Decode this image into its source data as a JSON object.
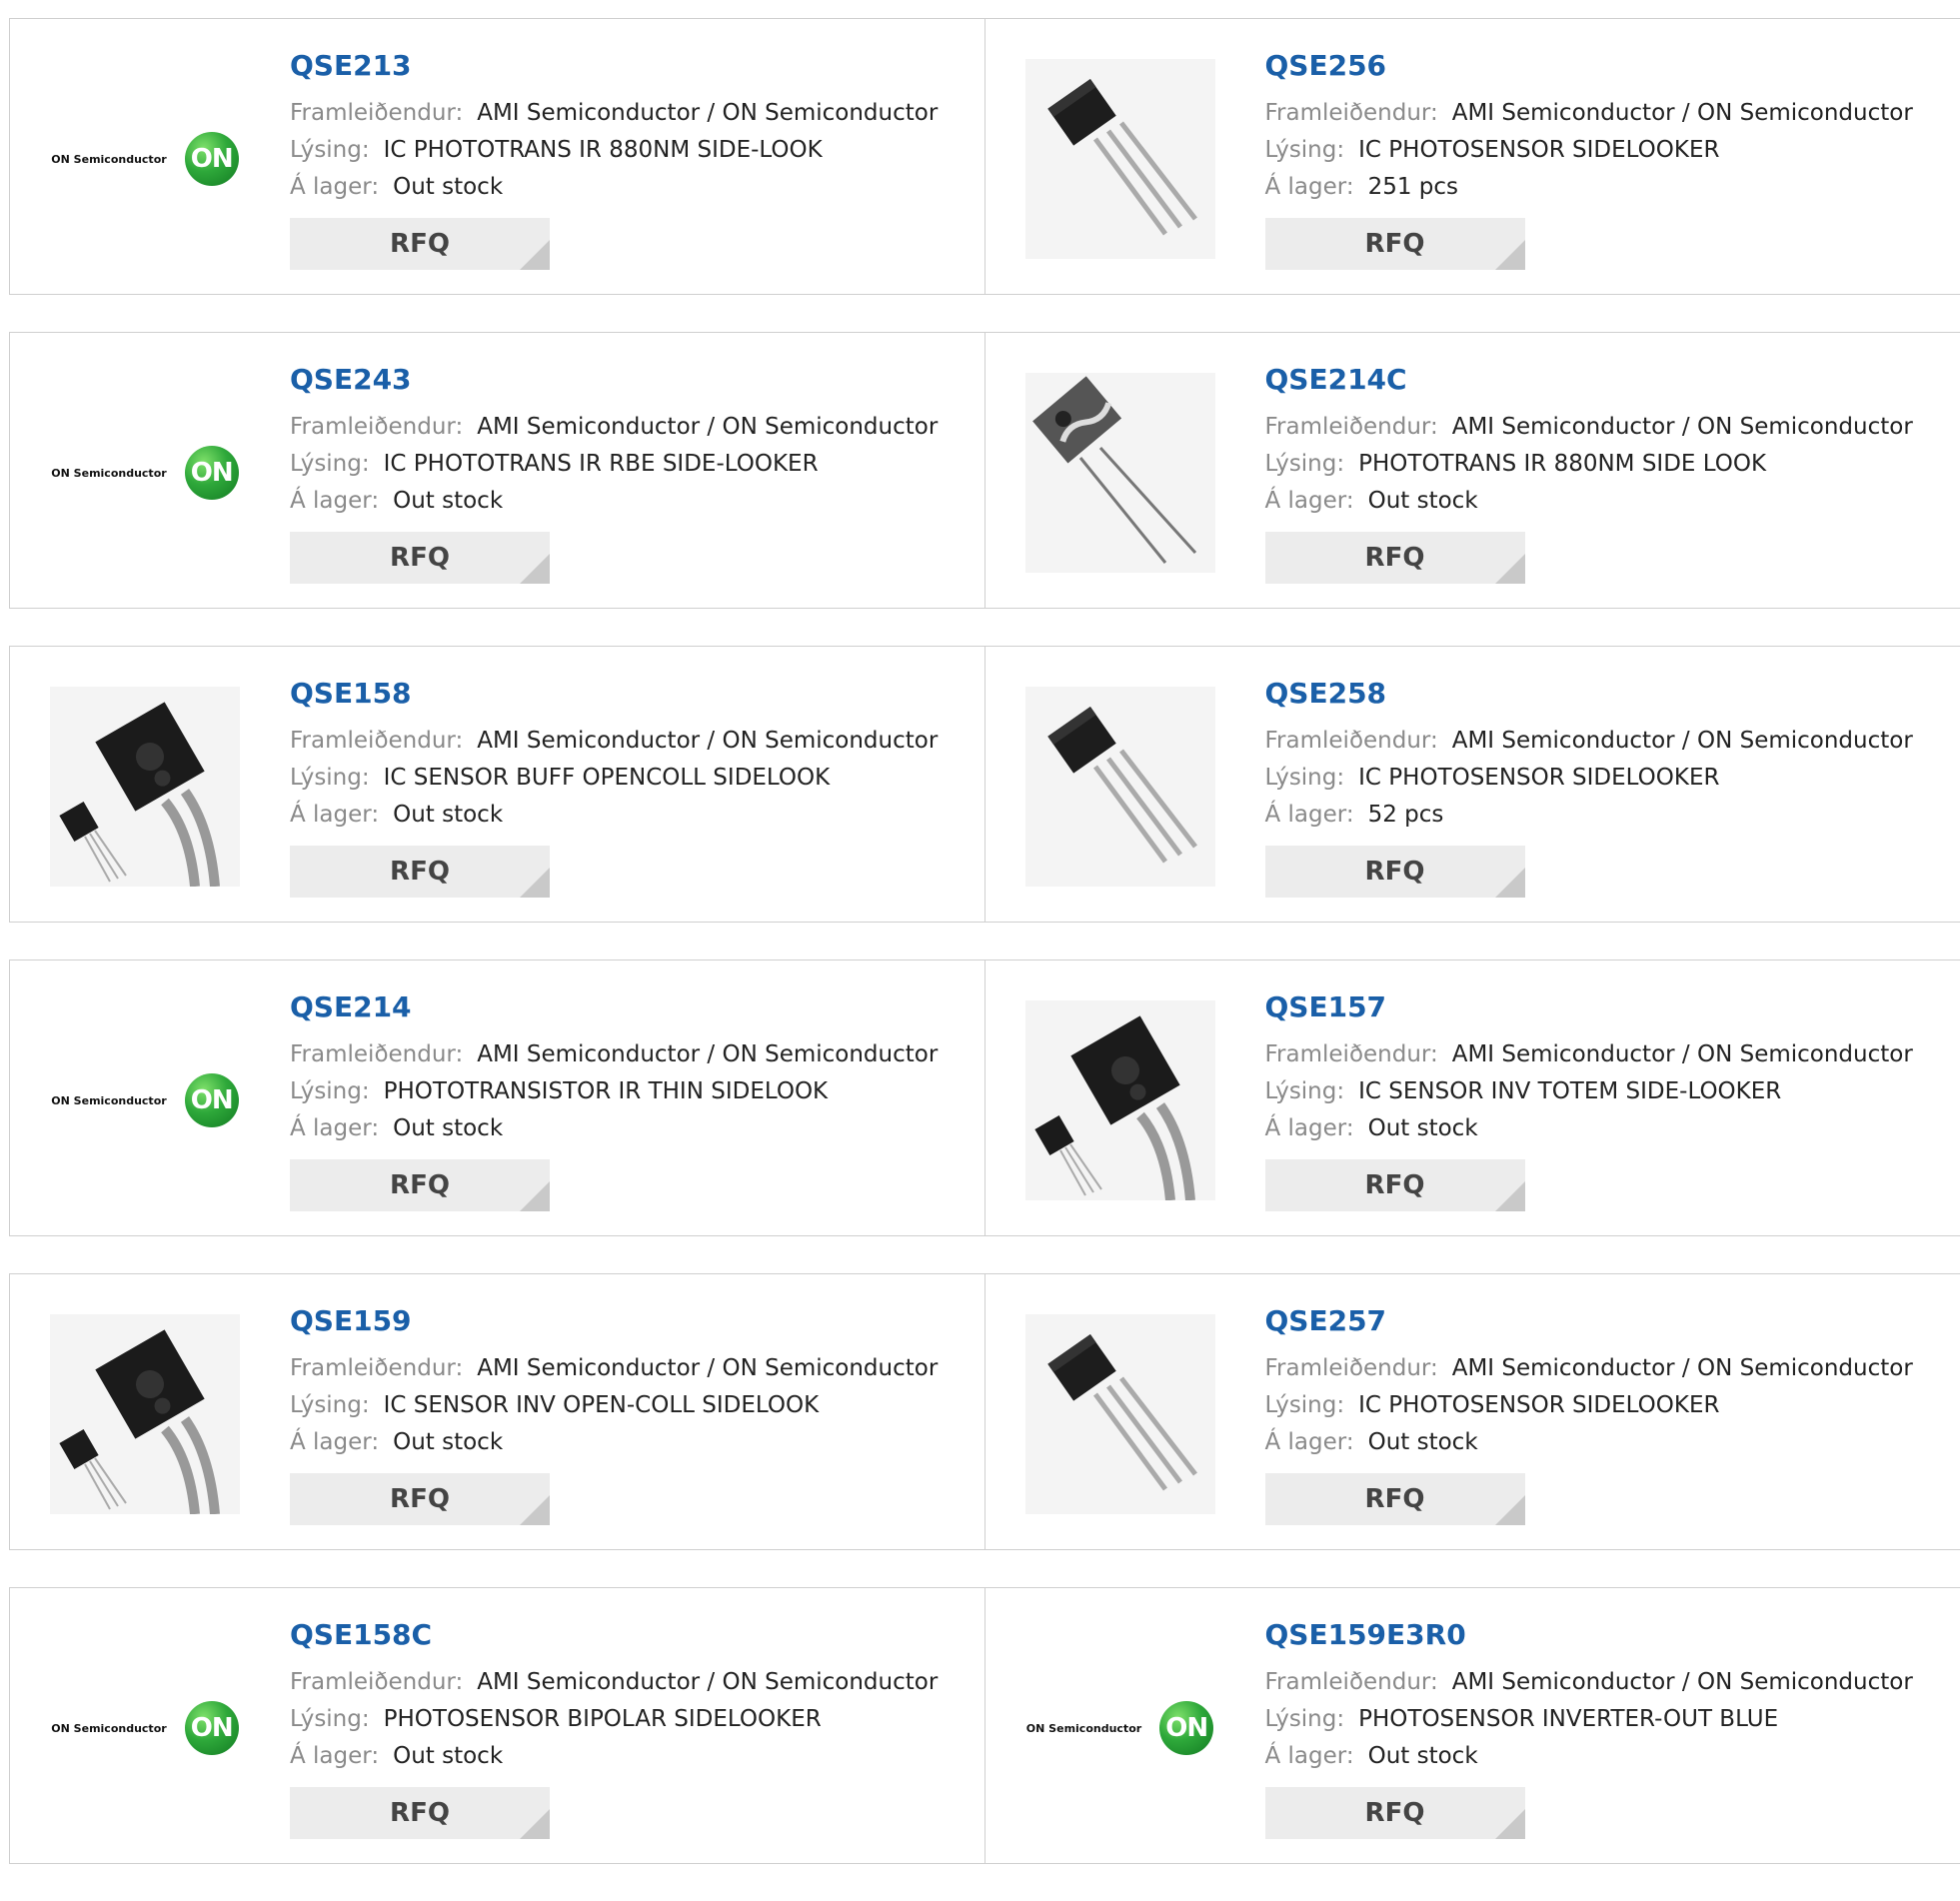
{
  "labels": {
    "manufacturer": "Framleiðendur:",
    "description": "Lýsing:",
    "stock": "Á lager:",
    "rfq": "RFQ"
  },
  "logo": {
    "company": "ON Semiconductor",
    "mark": "ON"
  },
  "products": [
    {
      "part": "QSE213",
      "manufacturer": "AMI Semiconductor / ON Semiconductor",
      "description": "IC PHOTOTRANS IR 880NM SIDE-LOOK",
      "stock": "Out stock",
      "image": "on-logo"
    },
    {
      "part": "QSE256",
      "manufacturer": "AMI Semiconductor / ON Semiconductor",
      "description": "IC PHOTOSENSOR SIDELOOKER",
      "stock": "251 pcs",
      "image": "to92-component"
    },
    {
      "part": "QSE243",
      "manufacturer": "AMI Semiconductor / ON Semiconductor",
      "description": "IC PHOTOTRANS IR RBE SIDE-LOOKER",
      "stock": "Out stock",
      "image": "on-logo"
    },
    {
      "part": "QSE214C",
      "manufacturer": "AMI Semiconductor / ON Semiconductor",
      "description": "PHOTOTRANS IR 880NM SIDE LOOK",
      "stock": "Out stock",
      "image": "flat-sensor-component"
    },
    {
      "part": "QSE158",
      "manufacturer": "AMI Semiconductor / ON Semiconductor",
      "description": "IC SENSOR BUFF OPENCOLL SIDELOOK",
      "stock": "Out stock",
      "image": "sidelooker-component"
    },
    {
      "part": "QSE258",
      "manufacturer": "AMI Semiconductor / ON Semiconductor",
      "description": "IC PHOTOSENSOR SIDELOOKER",
      "stock": "52 pcs",
      "image": "to92-component"
    },
    {
      "part": "QSE214",
      "manufacturer": "AMI Semiconductor / ON Semiconductor",
      "description": "PHOTOTRANSISTOR IR THIN SIDELOOK",
      "stock": "Out stock",
      "image": "on-logo"
    },
    {
      "part": "QSE157",
      "manufacturer": "AMI Semiconductor / ON Semiconductor",
      "description": "IC SENSOR INV TOTEM SIDE-LOOKER",
      "stock": "Out stock",
      "image": "sidelooker-component"
    },
    {
      "part": "QSE159",
      "manufacturer": "AMI Semiconductor / ON Semiconductor",
      "description": "IC SENSOR INV OPEN-COLL SIDELOOK",
      "stock": "Out stock",
      "image": "sidelooker-component"
    },
    {
      "part": "QSE257",
      "manufacturer": "AMI Semiconductor / ON Semiconductor",
      "description": "IC PHOTOSENSOR SIDELOOKER",
      "stock": "Out stock",
      "image": "to92-component"
    },
    {
      "part": "QSE158C",
      "manufacturer": "AMI Semiconductor / ON Semiconductor",
      "description": "PHOTOSENSOR BIPOLAR SIDELOOKER",
      "stock": "Out stock",
      "image": "on-logo"
    },
    {
      "part": "QSE159E3R0",
      "manufacturer": "AMI Semiconductor / ON Semiconductor",
      "description": "PHOTOSENSOR INVERTER-OUT BLUE",
      "stock": "Out stock",
      "image": "on-logo"
    }
  ],
  "colors": {
    "part_link": "#1a5fa8",
    "label": "#8a8a8a",
    "rfq_bg": "#ececec",
    "border": "#cfcfcf",
    "on_green": "#2ea83a"
  }
}
